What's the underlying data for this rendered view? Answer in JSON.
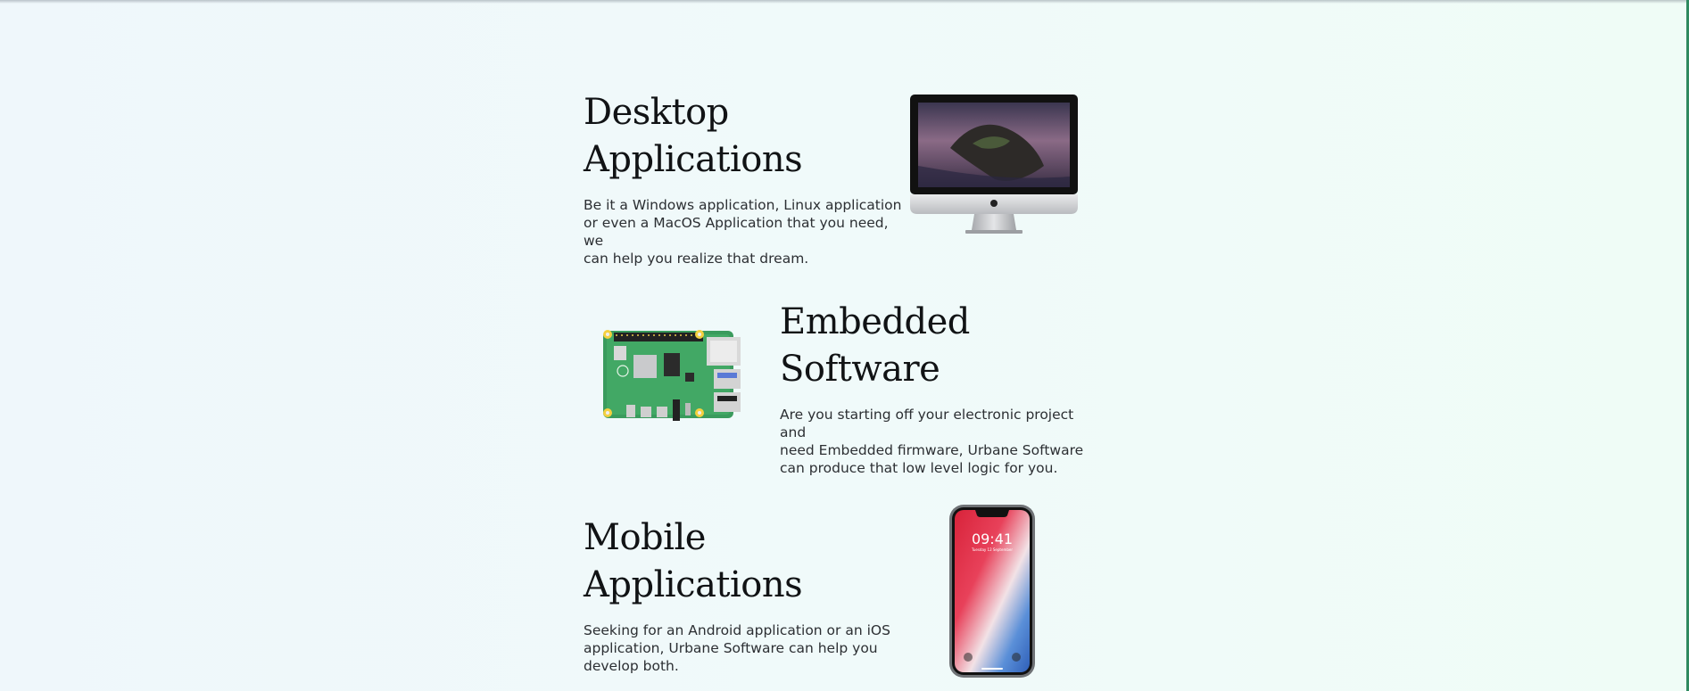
{
  "services": [
    {
      "title_line1": "Desktop",
      "title_line2": "Applications",
      "description_lines": [
        "Be it a Windows application, Linux application",
        "or even a MacOS Application that you need, we",
        "can help you realize that dream."
      ],
      "image_icon": "imac-icon"
    },
    {
      "title_line1": "Embedded",
      "title_line2": "Software",
      "description_lines": [
        "Are you starting off your electronic project and",
        "need Embedded firmware, Urbane Software",
        "can produce that low level logic for you."
      ],
      "image_icon": "raspberry-pi-board-icon"
    },
    {
      "title_line1": "Mobile",
      "title_line2": "Applications",
      "description_lines": [
        "Seeking for an Android application or an iOS",
        "application, Urbane Software can help you",
        "develop both."
      ],
      "image_icon": "smartphone-icon",
      "phone_time": "09:41",
      "phone_date": "Tuesday 12 September"
    }
  ],
  "colors": {
    "title": "#111315",
    "text": "#2c2f33",
    "board_green": "#3a9b5d",
    "accent_edge": "#2f8a5f"
  }
}
